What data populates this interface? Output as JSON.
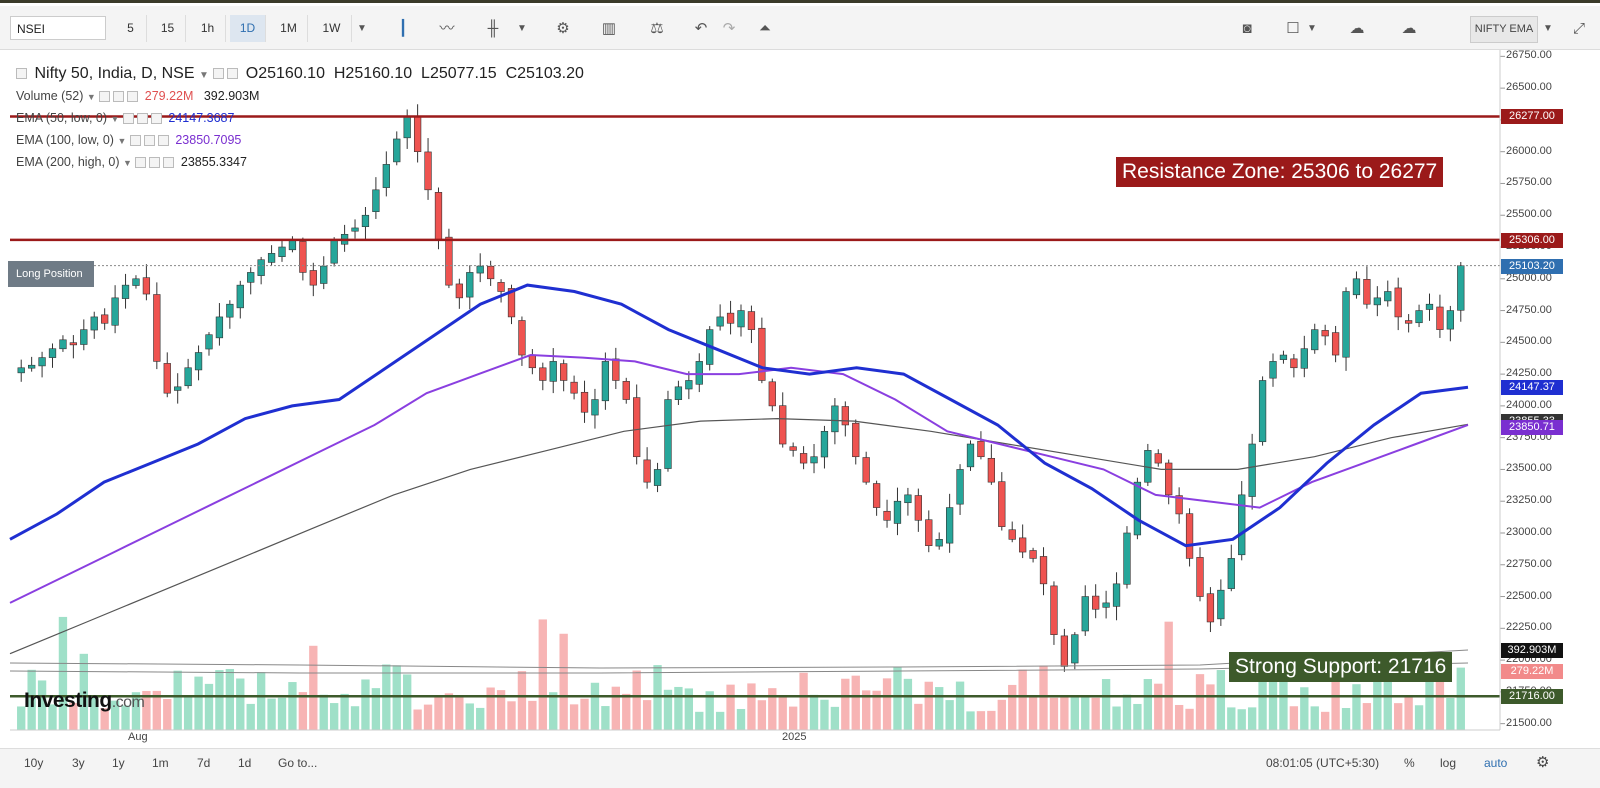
{
  "toolbar": {
    "symbol": "NSEI",
    "intervals": [
      "5",
      "15",
      "1h",
      "1D",
      "1M",
      "1W"
    ],
    "active_interval": "1D",
    "study_label": "NIFTY EMA"
  },
  "legend": {
    "title": "Nifty 50, India, D, NSE",
    "ohlc": {
      "o": "O25160.10",
      "h": "H25160.10",
      "l": "L25077.15",
      "c": "C25103.20"
    },
    "volume_label": "Volume (52)",
    "volume_a": "279.22M",
    "volume_b": "392.903M",
    "ema50_label": "EMA (50, low, 0)",
    "ema50_value": "24147.3687",
    "ema100_label": "EMA (100, low, 0)",
    "ema100_value": "23850.7095",
    "ema200_label": "EMA (200, high, 0)",
    "ema200_value": "23855.3347"
  },
  "long_position_label": "Long Position",
  "annotations": {
    "resistance": "Resistance Zone: 25306 to 26277",
    "support": "Strong Support: 21716"
  },
  "price_tags": {
    "resistance_top": "26277.00",
    "resistance_bottom": "25306.00",
    "last": "25103.20",
    "ema50": "24147.37",
    "ema200": "23855.33",
    "ema100": "23850.71",
    "vol_b": "392.903M",
    "vol_a": "279.22M",
    "support": "21716.00"
  },
  "y_axis_ticks": [
    "26750.00",
    "26500.00",
    "26250.00",
    "26000.00",
    "25750.00",
    "25500.00",
    "25250.00",
    "25000.00",
    "24750.00",
    "24500.00",
    "24250.00",
    "24000.00",
    "23750.00",
    "23500.00",
    "23250.00",
    "23000.00",
    "22750.00",
    "22500.00",
    "22250.00",
    "22000.00",
    "21750.00",
    "21500.00"
  ],
  "x_axis_labels": [
    "Aug",
    "2025"
  ],
  "watermark": {
    "brand": "Investing",
    "suffix": ".com"
  },
  "bottombar": {
    "ranges": [
      "10y",
      "3y",
      "1y",
      "1m",
      "7d",
      "1d",
      "Go to..."
    ],
    "clock": "08:01:05 (UTC+5:30)",
    "percent": "%",
    "log": "log",
    "auto": "auto"
  },
  "colors": {
    "up": "#26a69a",
    "down": "#ef5350",
    "ema50": "#1f2fd1",
    "ema100": "#8a3fe0",
    "ema200": "#555555",
    "resistance": "#9b1a1a",
    "support": "#3d5a2b"
  },
  "chart_data": {
    "type": "candlestick",
    "title": "Nifty 50, India, D, NSE",
    "ylim": [
      21450,
      26800
    ],
    "levels": [
      {
        "name": "Resistance Zone top",
        "value": 26277
      },
      {
        "name": "Resistance Zone bottom",
        "value": 25306
      },
      {
        "name": "Strong Support",
        "value": 21716
      }
    ],
    "ohlc_last": {
      "open": 25160.1,
      "high": 25160.1,
      "low": 25077.15,
      "close": 25103.2
    },
    "close_path": [
      24300,
      24320,
      24380,
      24450,
      24520,
      24480,
      24600,
      24700,
      24650,
      24850,
      24950,
      25000,
      24880,
      24350,
      24100,
      24150,
      24300,
      24420,
      24560,
      24700,
      24800,
      24950,
      25050,
      25150,
      25200,
      25250,
      25300,
      25050,
      24950,
      25100,
      25300,
      25350,
      25400,
      25500,
      25700,
      25900,
      26100,
      26277,
      26000,
      25700,
      25300,
      24950,
      24850,
      25050,
      25100,
      25000,
      24900,
      24700,
      24400,
      24300,
      24200,
      24350,
      24200,
      24100,
      23950,
      24050,
      24350,
      24200,
      24050,
      23600,
      23400,
      23500,
      24050,
      24150,
      24200,
      24350,
      24600,
      24700,
      24650,
      24750,
      24600,
      24200,
      24000,
      23700,
      23650,
      23550,
      23600,
      23800,
      24000,
      23850,
      23600,
      23400,
      23200,
      23100,
      23250,
      23300,
      23100,
      22900,
      22950,
      23200,
      23500,
      23700,
      23600,
      23400,
      23050,
      22950,
      22850,
      22800,
      22600,
      22200,
      21950,
      22200,
      22500,
      22400,
      22450,
      22600,
      23000,
      23400,
      23650,
      23550,
      23300,
      23150,
      22800,
      22500,
      22300,
      22550,
      22800,
      23300,
      23700,
      24200,
      24350,
      24400,
      24300,
      24450,
      24600,
      24550,
      24400,
      24900,
      25000,
      24800,
      24850,
      24900,
      24700,
      24650,
      24750,
      24800,
      24600,
      24750,
      25103
    ],
    "ema50_path": [
      22950,
      23150,
      23400,
      23550,
      23700,
      23900,
      24000,
      24050,
      24300,
      24550,
      24800,
      24950,
      24900,
      24800,
      24600,
      24450,
      24300,
      24250,
      24300,
      24250,
      24050,
      23850,
      23550,
      23350,
      23100,
      22900,
      22950,
      23200,
      23550,
      23850,
      24100,
      24147.37
    ],
    "ema100_path": [
      22450,
      22650,
      22850,
      23050,
      23250,
      23450,
      23650,
      23850,
      24100,
      24250,
      24400,
      24380,
      24350,
      24250,
      24250,
      24300,
      24250,
      24050,
      23800,
      23700,
      23600,
      23500,
      23300,
      23250,
      23200,
      23400,
      23550,
      23700,
      23850.71
    ],
    "ema200_path": [
      22050,
      22300,
      22550,
      22800,
      23050,
      23300,
      23500,
      23650,
      23800,
      23880,
      23900,
      23880,
      23800,
      23700,
      23600,
      23500,
      23500,
      23600,
      23750,
      23855.33
    ],
    "volume": {
      "series": [
        {
          "name": "Volume",
          "last_values": [
            "279.22M",
            "392.903M"
          ]
        }
      ]
    }
  }
}
